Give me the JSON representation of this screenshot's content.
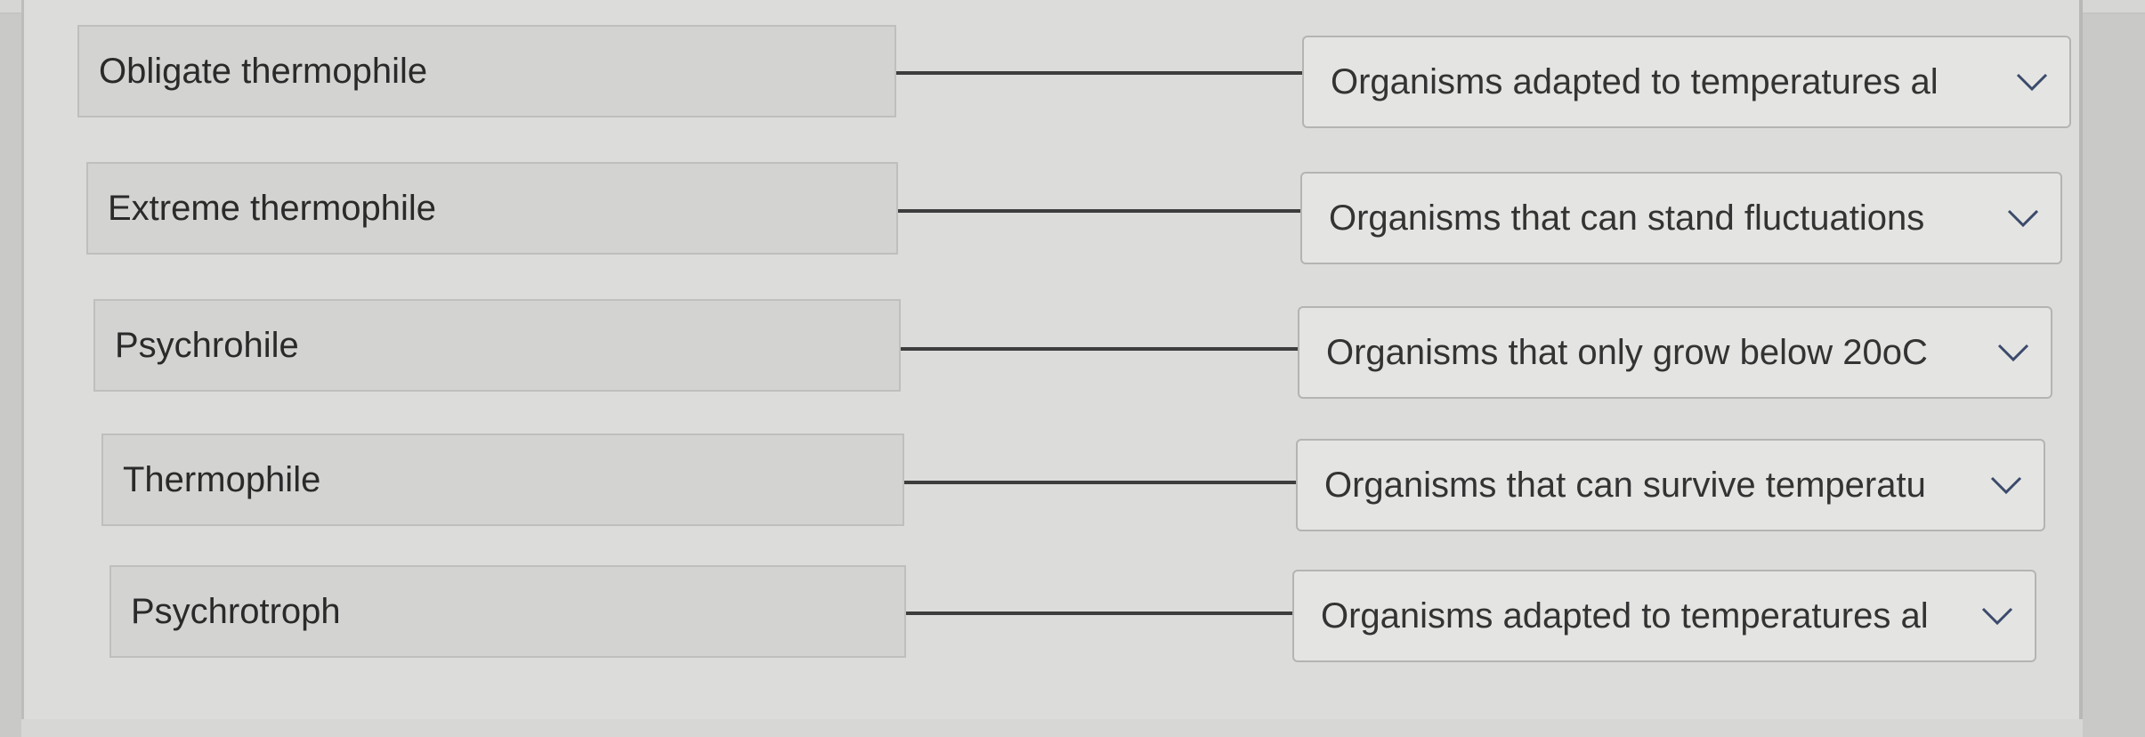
{
  "matching": {
    "rows": [
      {
        "term": "Obligate thermophile",
        "selected": "Organisms adapted to temperatures al"
      },
      {
        "term": "Extreme thermophile",
        "selected": "Organisms that can stand fluctuations"
      },
      {
        "term": "Psychrohile",
        "selected": "Organisms that only grow below 20oC"
      },
      {
        "term": "Thermophile",
        "selected": "Organisms that can survive temperatu"
      },
      {
        "term": "Psychrotroph",
        "selected": "Organisms adapted to temperatures al"
      }
    ]
  },
  "icons": {
    "dropdown": "chevron-down-icon"
  },
  "colors": {
    "connector": "#3d3d3d",
    "term_bg": "#d3d3d1",
    "dropdown_bg": "#e4e4e2"
  }
}
